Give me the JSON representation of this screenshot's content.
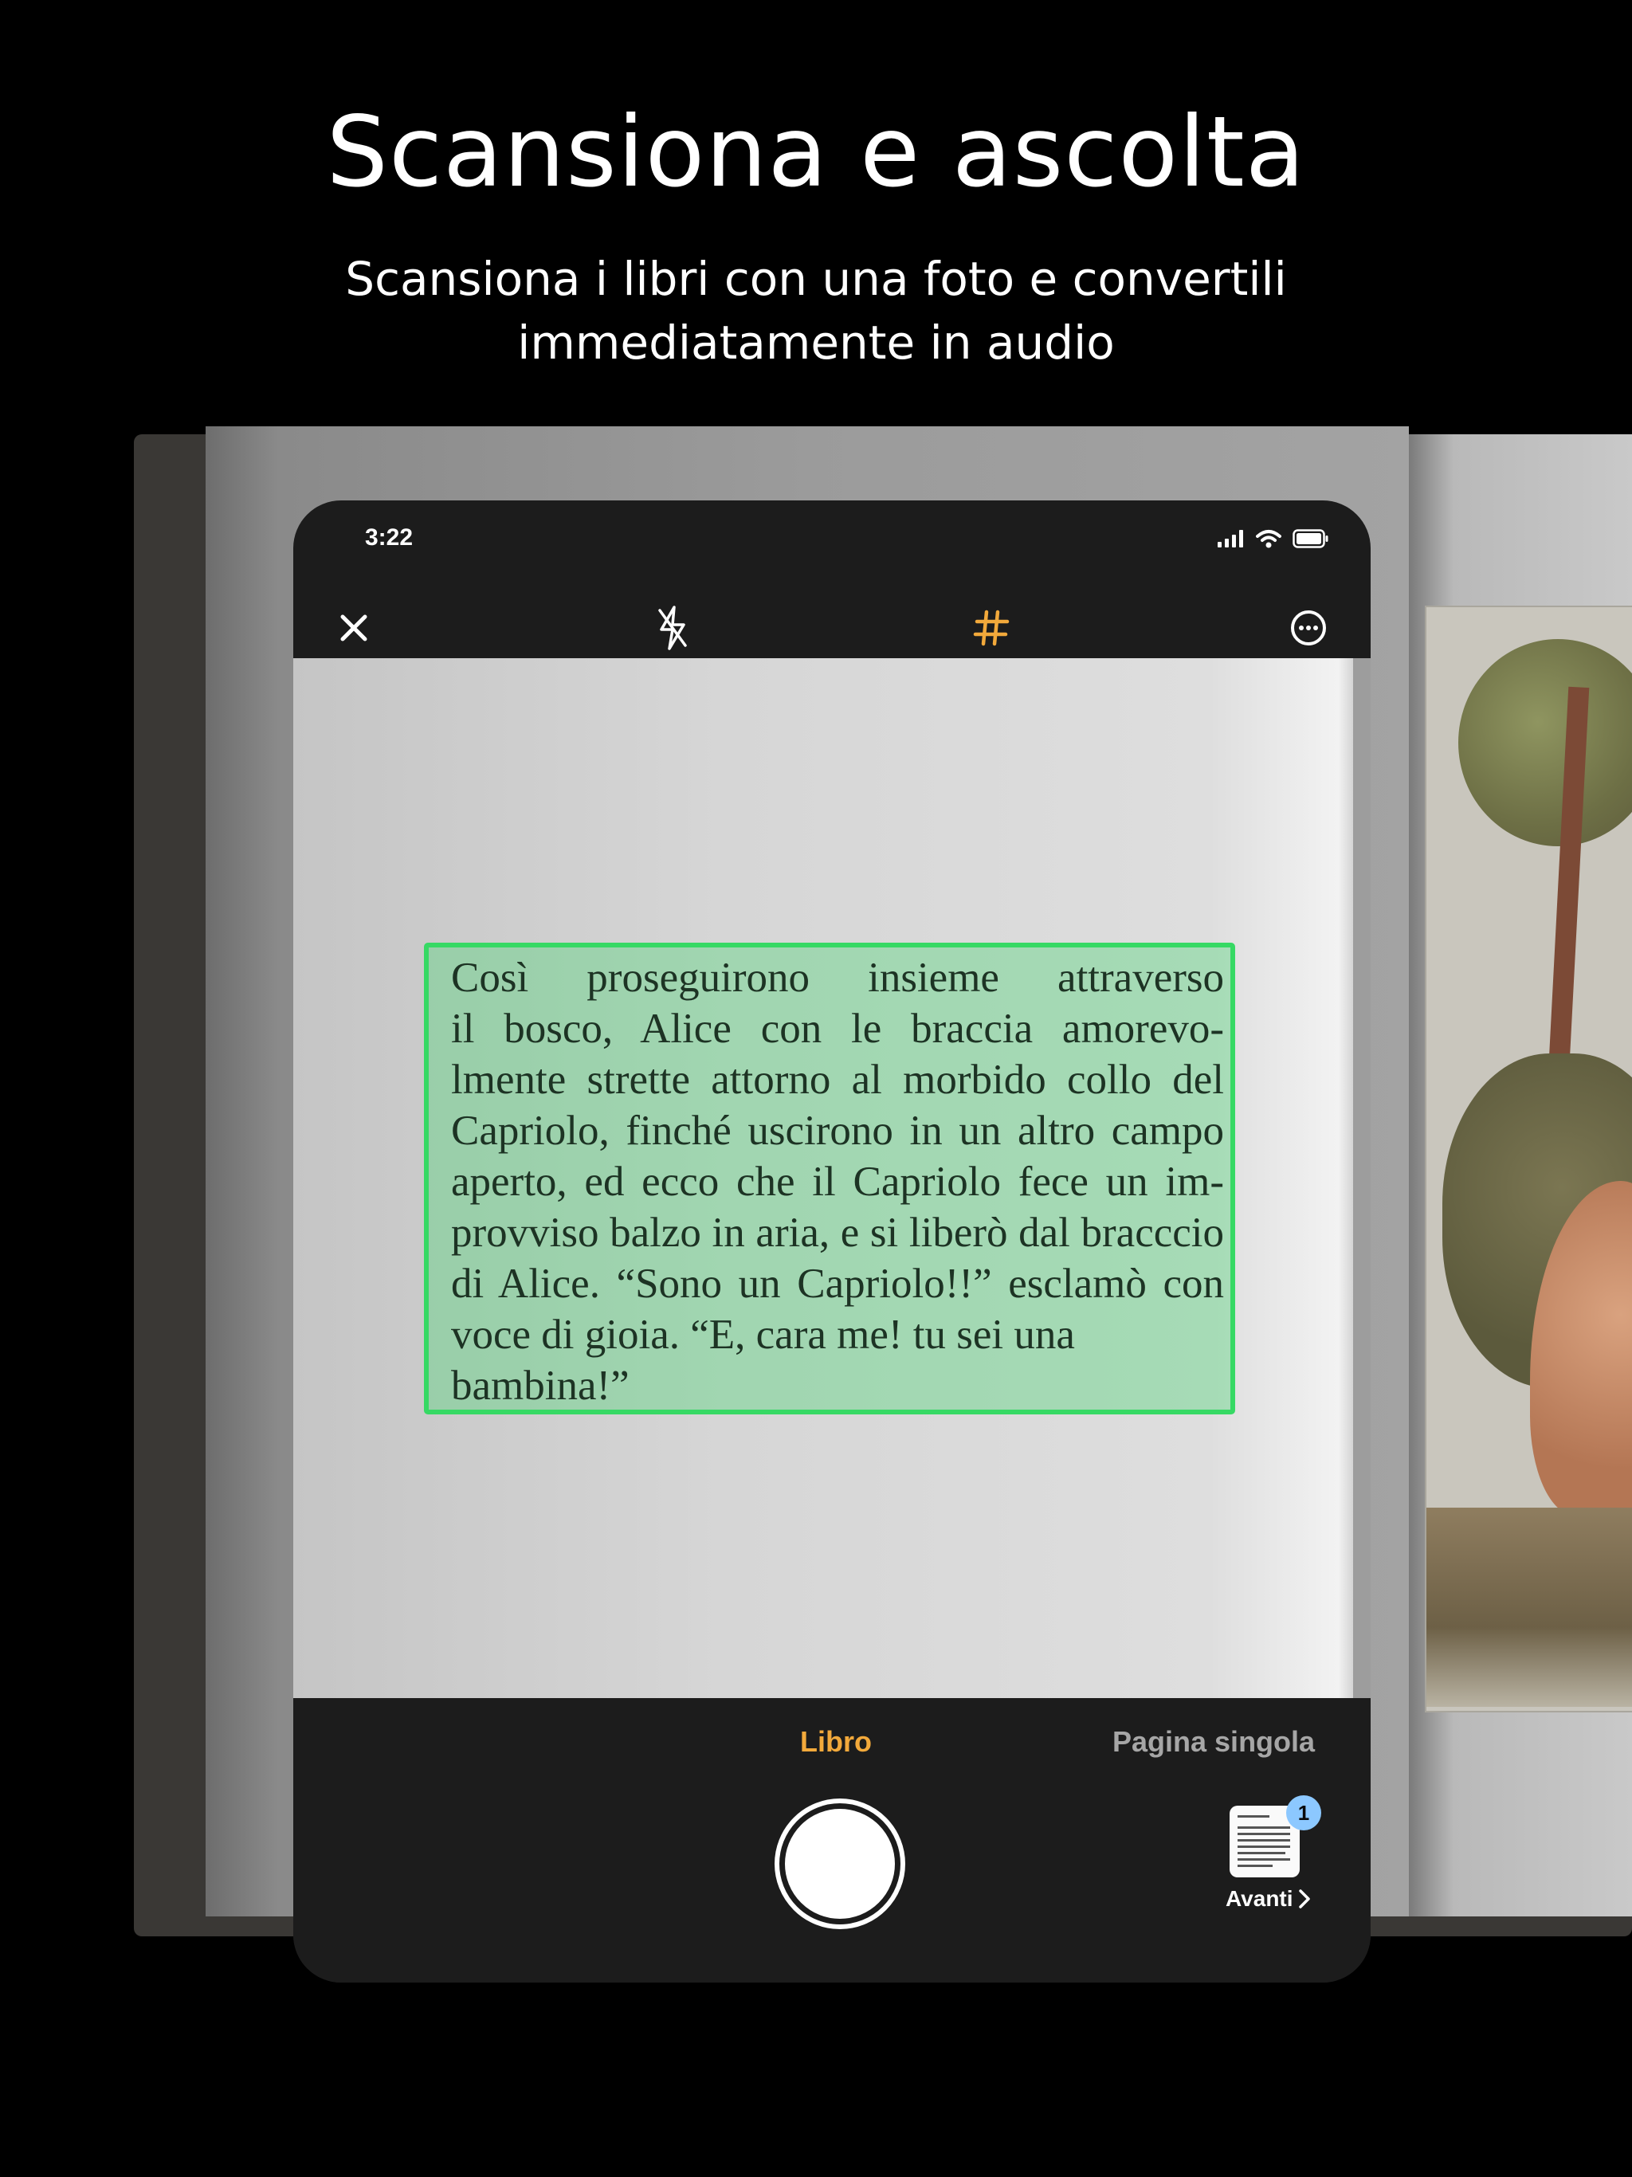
{
  "marketing": {
    "title": "Scansiona e ascolta",
    "subtitle": "Scansiona i libri con una foto e convertili immediatamente in audio"
  },
  "status_bar": {
    "time": "3:22",
    "icons": [
      "signal-icon",
      "wifi-icon",
      "battery-icon"
    ]
  },
  "toolbar": {
    "icons": [
      "close-icon",
      "flash-off-icon",
      "grid-icon",
      "more-icon"
    ],
    "active_color": "#f2a93b"
  },
  "scan": {
    "highlight_color": "#36d964",
    "lines": [
      "Così proseguirono insieme attraverso",
      "il bosco, Alice con le braccia amorevo-",
      "lmente strette attorno al morbido collo del",
      "Capriolo, finché uscirono in un altro campo",
      "aperto, ed ecco che il Capriolo fece un im-",
      "provviso balzo in aria, e si liberò dal bracccio",
      "di Alice. “Sono un Capriolo!!” esclamò con",
      "voce di gioia. “E, cara me! tu sei una",
      "bambina!”"
    ]
  },
  "modes": {
    "book": "Libro",
    "single_page": "Pagina singola",
    "selected": "Libro"
  },
  "capture": {
    "badge_count": "1",
    "next_label": "Avanti"
  }
}
